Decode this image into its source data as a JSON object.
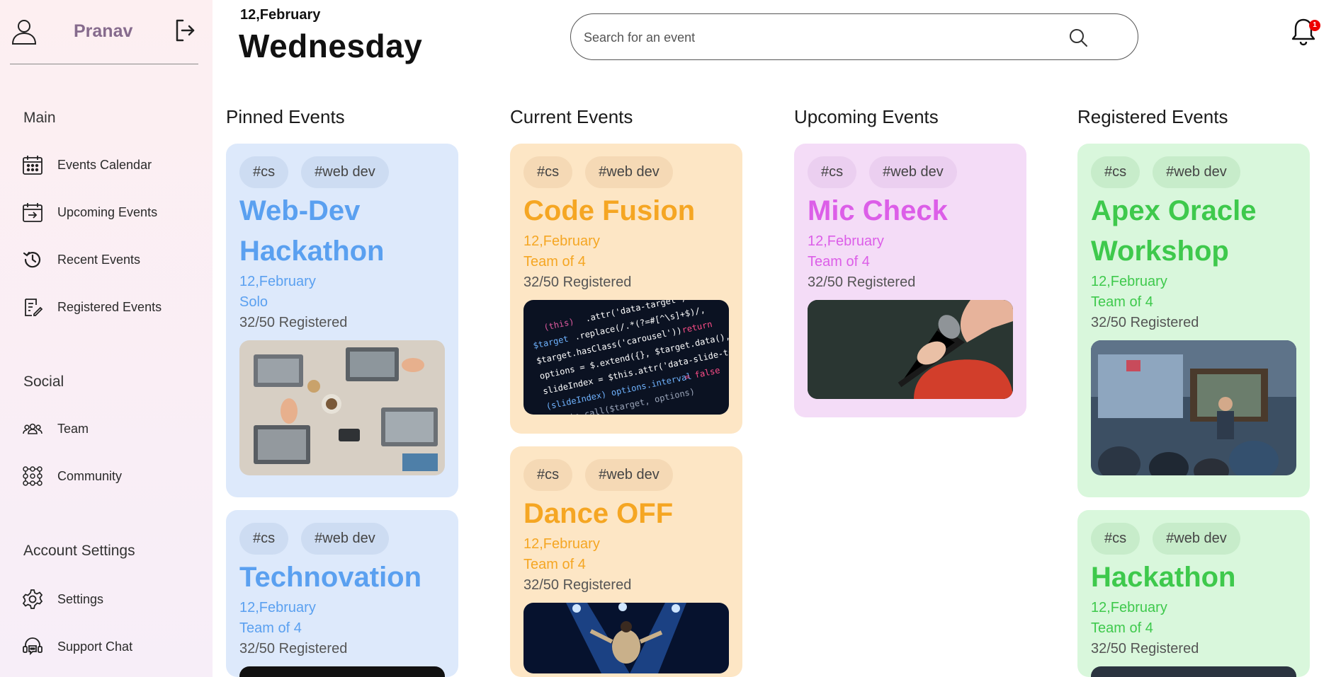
{
  "user": {
    "name": "Pranav"
  },
  "header": {
    "date": "12,February",
    "day": "Wednesday"
  },
  "search": {
    "placeholder": "Search for an event"
  },
  "notifications": {
    "count": "1"
  },
  "sidebar": {
    "sections": [
      {
        "title": "Main",
        "items": [
          {
            "label": "Events Calendar",
            "icon": "calendar-icon"
          },
          {
            "label": "Upcoming Events",
            "icon": "calendar-arrow-icon"
          },
          {
            "label": "Recent Events",
            "icon": "history-icon"
          },
          {
            "label": "Registered Events",
            "icon": "clipboard-edit-icon"
          }
        ]
      },
      {
        "title": "Social",
        "items": [
          {
            "label": "Team",
            "icon": "team-icon"
          },
          {
            "label": "Community",
            "icon": "community-icon"
          }
        ]
      },
      {
        "title": "Account Settings",
        "items": [
          {
            "label": "Settings",
            "icon": "gear-icon"
          },
          {
            "label": "Support Chat",
            "icon": "headset-chat-icon"
          }
        ]
      }
    ]
  },
  "columns": [
    {
      "title": "Pinned Events",
      "color": "#5aa0f0",
      "cards": [
        {
          "tags": [
            "#cs",
            "#web dev"
          ],
          "title_lines": [
            "Web-Dev",
            "Hackathon"
          ],
          "date": "12,February",
          "team": "Solo",
          "registered": "32/50 Registered",
          "image": "laptops-on-table-image"
        },
        {
          "tags": [
            "#cs",
            "#web dev"
          ],
          "title_lines": [
            "Technovation"
          ],
          "date": "12,February",
          "team": "Team of 4",
          "registered": "32/50 Registered",
          "image": "event-image"
        }
      ]
    },
    {
      "title": "Current Events",
      "color": "#f5a623",
      "cards": [
        {
          "tags": [
            "#cs",
            "#web dev"
          ],
          "title_lines": [
            "Code Fusion"
          ],
          "date": "12,February",
          "team": "Team of 4",
          "registered": "32/50 Registered",
          "image": "code-screen-image"
        },
        {
          "tags": [
            "#cs",
            "#web dev"
          ],
          "title_lines": [
            "Dance OFF"
          ],
          "date": "12,February",
          "team": "Team of 4",
          "registered": "32/50 Registered",
          "image": "dancer-stage-image"
        }
      ]
    },
    {
      "title": "Upcoming Events",
      "color": "#dc5ee8",
      "cards": [
        {
          "tags": [
            "#cs",
            "#web dev"
          ],
          "title_lines": [
            "Mic Check"
          ],
          "date": "12,February",
          "team": "Team of 4",
          "registered": "32/50 Registered",
          "image": "microphone-singer-image"
        }
      ]
    },
    {
      "title": "Registered Events",
      "color": "#3ec94c",
      "cards": [
        {
          "tags": [
            "#cs",
            "#web dev"
          ],
          "title_lines": [
            "Apex Oracle",
            "Workshop"
          ],
          "date": "12,February",
          "team": "Team of 4",
          "registered": "32/50 Registered",
          "image": "workshop-classroom-image"
        },
        {
          "tags": [
            "#cs",
            "#web dev"
          ],
          "title_lines": [
            "Hackathon"
          ],
          "date": "12,February",
          "team": "Team of 4",
          "registered": "32/50 Registered",
          "image": "event-image"
        }
      ]
    }
  ]
}
